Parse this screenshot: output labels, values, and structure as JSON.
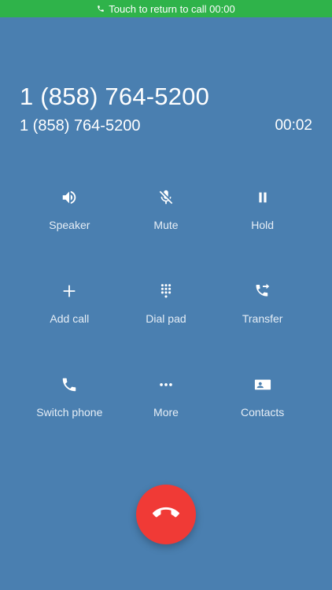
{
  "status_bar": {
    "text": "Touch to return to call 00:00",
    "color": "#2fb34a",
    "icon": "phone-icon"
  },
  "call": {
    "name": "1 (858) 764-5200",
    "number": "1 (858) 764-5200",
    "timer": "00:02"
  },
  "controls": [
    {
      "label": "Speaker",
      "icon": "speaker-icon"
    },
    {
      "label": "Mute",
      "icon": "mic-off-icon"
    },
    {
      "label": "Hold",
      "icon": "pause-icon"
    },
    {
      "label": "Add call",
      "icon": "plus-icon"
    },
    {
      "label": "Dial pad",
      "icon": "dialpad-icon"
    },
    {
      "label": "Transfer",
      "icon": "transfer-call-icon"
    },
    {
      "label": "Switch phone",
      "icon": "phone-icon"
    },
    {
      "label": "More",
      "icon": "more-dots-icon"
    },
    {
      "label": "Contacts",
      "icon": "contact-card-icon"
    }
  ],
  "end_call": {
    "icon": "hang-up-icon",
    "color": "#f03a36"
  },
  "colors": {
    "background": "#4a7fb0",
    "text": "#ffffff"
  }
}
